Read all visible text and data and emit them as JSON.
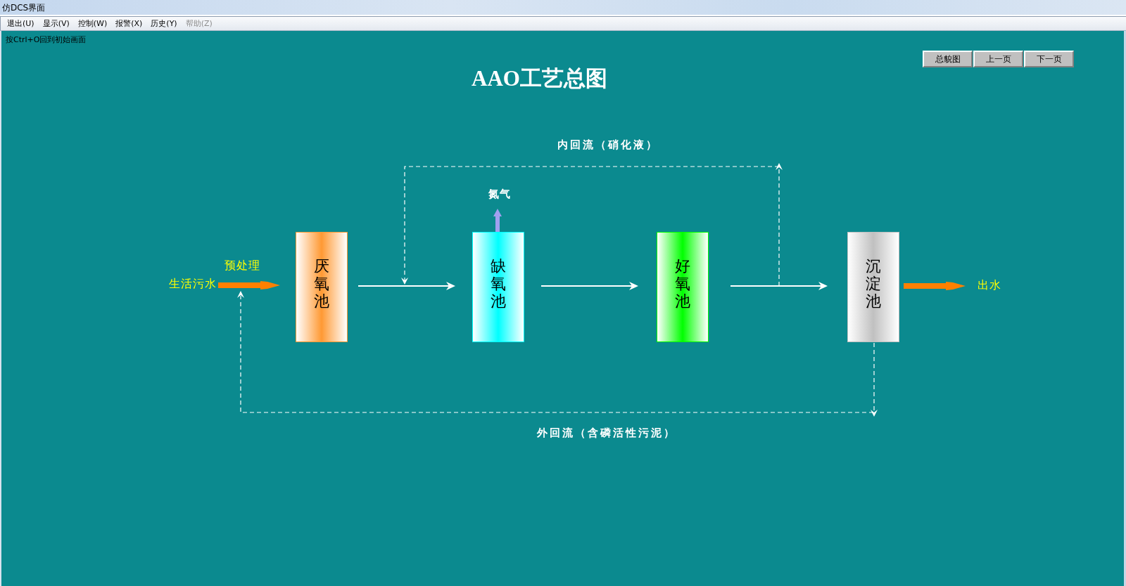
{
  "window": {
    "title": "仿DCS界面"
  },
  "menu": [
    {
      "label": "退出(U)",
      "disabled": false
    },
    {
      "label": "显示(V)",
      "disabled": false
    },
    {
      "label": "控制(W)",
      "disabled": false
    },
    {
      "label": "报警(X)",
      "disabled": false
    },
    {
      "label": "历史(Y)",
      "disabled": false
    },
    {
      "label": "帮助(Z)",
      "disabled": true
    }
  ],
  "screen": {
    "hint": "按Ctrl+O回到初始画面",
    "nav_buttons": [
      "总貌图",
      "上一页",
      "下一页"
    ],
    "title": "AAO工艺总图",
    "diagram": {
      "influent": {
        "label": "生活污水",
        "pretreatment": "预处理"
      },
      "tanks": [
        {
          "label": "厌氧池",
          "color": "#ff9933"
        },
        {
          "label": "缺氧池",
          "color": "#00ffff"
        },
        {
          "label": "好氧池",
          "color": "#00ff00"
        },
        {
          "label": "沉淀池",
          "color": "#c0c0c0"
        }
      ],
      "gas": {
        "label": "氮气"
      },
      "effluent": {
        "label": "出水"
      },
      "internal_recycle": {
        "label": "内回流（硝化液）"
      },
      "external_recycle": {
        "label": "外回流（含磷活性污泥）"
      }
    }
  }
}
